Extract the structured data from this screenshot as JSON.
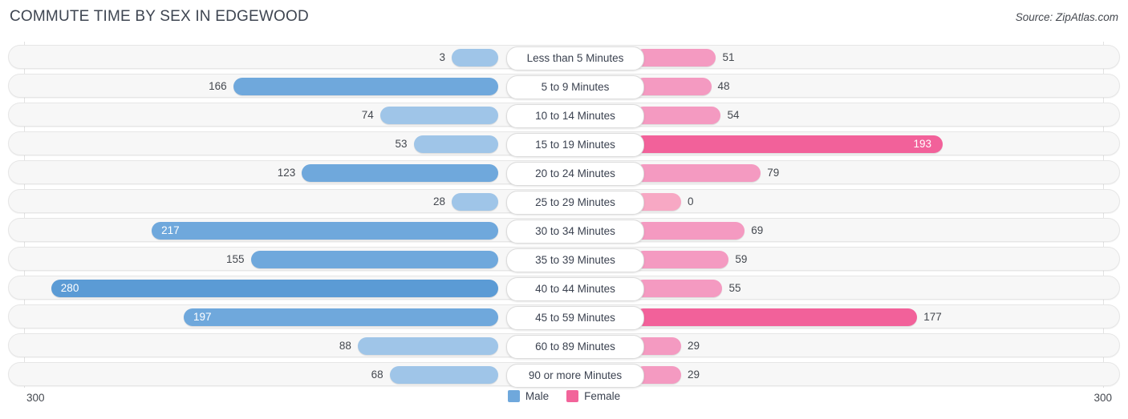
{
  "header": {
    "title": "COMMUTE TIME BY SEX IN EDGEWOOD",
    "source": "Source: ZipAtlas.com"
  },
  "legend": {
    "male_label": "Male",
    "female_label": "Female",
    "male_color": "#6fa8dc",
    "female_color": "#f2649a"
  },
  "axis": {
    "left_label": "300",
    "right_label": "300",
    "max": 300
  },
  "colors": {
    "male_light": "#9fc5e8",
    "male_mid": "#6fa8dc",
    "male_dark": "#5b9bd5",
    "female_light": "#f7a8c4",
    "female_mid": "#f49ac1",
    "female_dark": "#f2619a"
  },
  "chart_data": {
    "type": "bar",
    "title": "COMMUTE TIME BY SEX IN EDGEWOOD",
    "subtitle": "Source: ZipAtlas.com",
    "orientation": "horizontal-diverging",
    "xlabel": "",
    "ylabel": "",
    "xlim": [
      -300,
      300
    ],
    "grid": true,
    "legend_position": "bottom-center",
    "categories": [
      "Less than 5 Minutes",
      "5 to 9 Minutes",
      "10 to 14 Minutes",
      "15 to 19 Minutes",
      "20 to 24 Minutes",
      "25 to 29 Minutes",
      "30 to 34 Minutes",
      "35 to 39 Minutes",
      "40 to 44 Minutes",
      "45 to 59 Minutes",
      "60 to 89 Minutes",
      "90 or more Minutes"
    ],
    "series": [
      {
        "name": "Male",
        "color": "#6fa8dc",
        "values": [
          3,
          166,
          74,
          53,
          123,
          28,
          217,
          155,
          280,
          197,
          88,
          68
        ]
      },
      {
        "name": "Female",
        "color": "#f2649a",
        "values": [
          51,
          48,
          54,
          193,
          79,
          0,
          69,
          59,
          55,
          177,
          29,
          29
        ]
      }
    ]
  },
  "rows": [
    {
      "label": "Less than 5 Minutes",
      "male": "3",
      "female": "51",
      "male_tone": "light",
      "female_tone": "mid",
      "male_inside": false,
      "female_inside": false
    },
    {
      "label": "5 to 9 Minutes",
      "male": "166",
      "female": "48",
      "male_tone": "mid",
      "female_tone": "mid",
      "male_inside": false,
      "female_inside": false
    },
    {
      "label": "10 to 14 Minutes",
      "male": "74",
      "female": "54",
      "male_tone": "light",
      "female_tone": "mid",
      "male_inside": false,
      "female_inside": false
    },
    {
      "label": "15 to 19 Minutes",
      "male": "53",
      "female": "193",
      "male_tone": "light",
      "female_tone": "dark",
      "male_inside": false,
      "female_inside": true
    },
    {
      "label": "20 to 24 Minutes",
      "male": "123",
      "female": "79",
      "male_tone": "mid",
      "female_tone": "mid",
      "male_inside": false,
      "female_inside": false
    },
    {
      "label": "25 to 29 Minutes",
      "male": "28",
      "female": "0",
      "male_tone": "light",
      "female_tone": "light",
      "male_inside": false,
      "female_inside": false
    },
    {
      "label": "30 to 34 Minutes",
      "male": "217",
      "female": "69",
      "male_tone": "mid",
      "female_tone": "mid",
      "male_inside": true,
      "female_inside": false
    },
    {
      "label": "35 to 39 Minutes",
      "male": "155",
      "female": "59",
      "male_tone": "mid",
      "female_tone": "mid",
      "male_inside": false,
      "female_inside": false
    },
    {
      "label": "40 to 44 Minutes",
      "male": "280",
      "female": "55",
      "male_tone": "dark",
      "female_tone": "mid",
      "male_inside": true,
      "female_inside": false
    },
    {
      "label": "45 to 59 Minutes",
      "male": "197",
      "female": "177",
      "male_tone": "mid",
      "female_tone": "dark",
      "male_inside": true,
      "female_inside": false
    },
    {
      "label": "60 to 89 Minutes",
      "male": "88",
      "female": "29",
      "male_tone": "light",
      "female_tone": "mid",
      "male_inside": false,
      "female_inside": false
    },
    {
      "label": "90 or more Minutes",
      "male": "68",
      "female": "29",
      "male_tone": "light",
      "female_tone": "mid",
      "male_inside": false,
      "female_inside": false
    }
  ]
}
